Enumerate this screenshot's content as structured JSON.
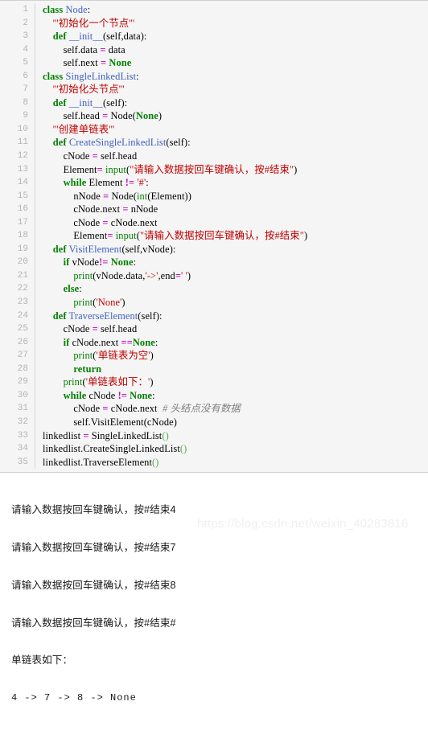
{
  "code_block": {
    "language": "python",
    "line_numbers": [
      1,
      2,
      3,
      4,
      5,
      6,
      7,
      8,
      9,
      10,
      11,
      12,
      13,
      14,
      15,
      16,
      17,
      18,
      19,
      20,
      21,
      22,
      23,
      24,
      25,
      26,
      27,
      28,
      29,
      30,
      31,
      32,
      33,
      34,
      35
    ],
    "lines": [
      "class Node:",
      "    '''初始化一个节点'''",
      "    def __init__(self,data):",
      "        self.data = data",
      "        self.next = None",
      "class SingleLinkedList:",
      "    '''初始化头节点'''",
      "    def __init__(self):",
      "        self.head = Node(None)",
      "    '''创建单链表'''",
      "    def CreateSingleLinkedList(self):",
      "        cNode = self.head",
      "        Element= input(\"请输入数据按回车键确认，按#结束\")",
      "        while Element != '#':",
      "            nNode = Node(int(Element))",
      "            cNode.next = nNode",
      "            cNode = cNode.next",
      "            Element= input(\"请输入数据按回车键确认，按#结束\")",
      "    def VisitElement(self,vNode):",
      "        if vNode!= None:",
      "            print(vNode.data,'->',end=' ')",
      "        else:",
      "            print('None')",
      "    def TraverseElement(self):",
      "        cNode = self.head",
      "        if cNode.next ==None:",
      "            print('单链表为空')",
      "            return",
      "        print('单链表如下：')",
      "        while cNode != None:",
      "            cNode = cNode.next  # 头结点没有数据",
      "            self.VisitElement(cNode)",
      "linkedlist = SingleLinkedList()",
      "linkedlist.CreateSingleLinkedList()",
      "linkedlist.TraverseElement()"
    ]
  },
  "console": {
    "lines": [
      "请输入数据按回车键确认，按#结束4",
      "请输入数据按回车键确认，按#结束7",
      "请输入数据按回车键确认，按#结束8",
      "请输入数据按回车键确认，按#结束#",
      "单链表如下：",
      "4 -> 7 -> 8 -> None"
    ],
    "watermark": "https://blog.csdn.net/weixin_40283816"
  },
  "colors": {
    "background": "#ffffff",
    "code_background": "#f5f5f5",
    "gutter_text": "#b4b4b4",
    "keyword": "#007f00",
    "class_name": "#4060c0",
    "string": "#c00000",
    "operator": "#c000c0",
    "comment": "#808080",
    "watermark": "#f0f0f0"
  }
}
